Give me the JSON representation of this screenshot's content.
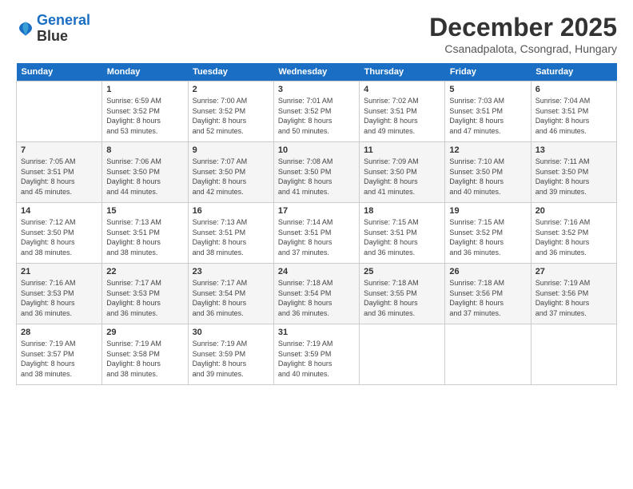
{
  "logo": {
    "line1": "General",
    "line2": "Blue"
  },
  "title": "December 2025",
  "subtitle": "Csanadpalota, Csongrad, Hungary",
  "weekdays": [
    "Sunday",
    "Monday",
    "Tuesday",
    "Wednesday",
    "Thursday",
    "Friday",
    "Saturday"
  ],
  "weeks": [
    [
      {
        "day": "",
        "info": ""
      },
      {
        "day": "1",
        "info": "Sunrise: 6:59 AM\nSunset: 3:52 PM\nDaylight: 8 hours\nand 53 minutes."
      },
      {
        "day": "2",
        "info": "Sunrise: 7:00 AM\nSunset: 3:52 PM\nDaylight: 8 hours\nand 52 minutes."
      },
      {
        "day": "3",
        "info": "Sunrise: 7:01 AM\nSunset: 3:52 PM\nDaylight: 8 hours\nand 50 minutes."
      },
      {
        "day": "4",
        "info": "Sunrise: 7:02 AM\nSunset: 3:51 PM\nDaylight: 8 hours\nand 49 minutes."
      },
      {
        "day": "5",
        "info": "Sunrise: 7:03 AM\nSunset: 3:51 PM\nDaylight: 8 hours\nand 47 minutes."
      },
      {
        "day": "6",
        "info": "Sunrise: 7:04 AM\nSunset: 3:51 PM\nDaylight: 8 hours\nand 46 minutes."
      }
    ],
    [
      {
        "day": "7",
        "info": "Sunrise: 7:05 AM\nSunset: 3:51 PM\nDaylight: 8 hours\nand 45 minutes."
      },
      {
        "day": "8",
        "info": "Sunrise: 7:06 AM\nSunset: 3:50 PM\nDaylight: 8 hours\nand 44 minutes."
      },
      {
        "day": "9",
        "info": "Sunrise: 7:07 AM\nSunset: 3:50 PM\nDaylight: 8 hours\nand 42 minutes."
      },
      {
        "day": "10",
        "info": "Sunrise: 7:08 AM\nSunset: 3:50 PM\nDaylight: 8 hours\nand 41 minutes."
      },
      {
        "day": "11",
        "info": "Sunrise: 7:09 AM\nSunset: 3:50 PM\nDaylight: 8 hours\nand 41 minutes."
      },
      {
        "day": "12",
        "info": "Sunrise: 7:10 AM\nSunset: 3:50 PM\nDaylight: 8 hours\nand 40 minutes."
      },
      {
        "day": "13",
        "info": "Sunrise: 7:11 AM\nSunset: 3:50 PM\nDaylight: 8 hours\nand 39 minutes."
      }
    ],
    [
      {
        "day": "14",
        "info": "Sunrise: 7:12 AM\nSunset: 3:50 PM\nDaylight: 8 hours\nand 38 minutes."
      },
      {
        "day": "15",
        "info": "Sunrise: 7:13 AM\nSunset: 3:51 PM\nDaylight: 8 hours\nand 38 minutes."
      },
      {
        "day": "16",
        "info": "Sunrise: 7:13 AM\nSunset: 3:51 PM\nDaylight: 8 hours\nand 38 minutes."
      },
      {
        "day": "17",
        "info": "Sunrise: 7:14 AM\nSunset: 3:51 PM\nDaylight: 8 hours\nand 37 minutes."
      },
      {
        "day": "18",
        "info": "Sunrise: 7:15 AM\nSunset: 3:51 PM\nDaylight: 8 hours\nand 36 minutes."
      },
      {
        "day": "19",
        "info": "Sunrise: 7:15 AM\nSunset: 3:52 PM\nDaylight: 8 hours\nand 36 minutes."
      },
      {
        "day": "20",
        "info": "Sunrise: 7:16 AM\nSunset: 3:52 PM\nDaylight: 8 hours\nand 36 minutes."
      }
    ],
    [
      {
        "day": "21",
        "info": "Sunrise: 7:16 AM\nSunset: 3:53 PM\nDaylight: 8 hours\nand 36 minutes."
      },
      {
        "day": "22",
        "info": "Sunrise: 7:17 AM\nSunset: 3:53 PM\nDaylight: 8 hours\nand 36 minutes."
      },
      {
        "day": "23",
        "info": "Sunrise: 7:17 AM\nSunset: 3:54 PM\nDaylight: 8 hours\nand 36 minutes."
      },
      {
        "day": "24",
        "info": "Sunrise: 7:18 AM\nSunset: 3:54 PM\nDaylight: 8 hours\nand 36 minutes."
      },
      {
        "day": "25",
        "info": "Sunrise: 7:18 AM\nSunset: 3:55 PM\nDaylight: 8 hours\nand 36 minutes."
      },
      {
        "day": "26",
        "info": "Sunrise: 7:18 AM\nSunset: 3:56 PM\nDaylight: 8 hours\nand 37 minutes."
      },
      {
        "day": "27",
        "info": "Sunrise: 7:19 AM\nSunset: 3:56 PM\nDaylight: 8 hours\nand 37 minutes."
      }
    ],
    [
      {
        "day": "28",
        "info": "Sunrise: 7:19 AM\nSunset: 3:57 PM\nDaylight: 8 hours\nand 38 minutes."
      },
      {
        "day": "29",
        "info": "Sunrise: 7:19 AM\nSunset: 3:58 PM\nDaylight: 8 hours\nand 38 minutes."
      },
      {
        "day": "30",
        "info": "Sunrise: 7:19 AM\nSunset: 3:59 PM\nDaylight: 8 hours\nand 39 minutes."
      },
      {
        "day": "31",
        "info": "Sunrise: 7:19 AM\nSunset: 3:59 PM\nDaylight: 8 hours\nand 40 minutes."
      },
      {
        "day": "",
        "info": ""
      },
      {
        "day": "",
        "info": ""
      },
      {
        "day": "",
        "info": ""
      }
    ]
  ]
}
